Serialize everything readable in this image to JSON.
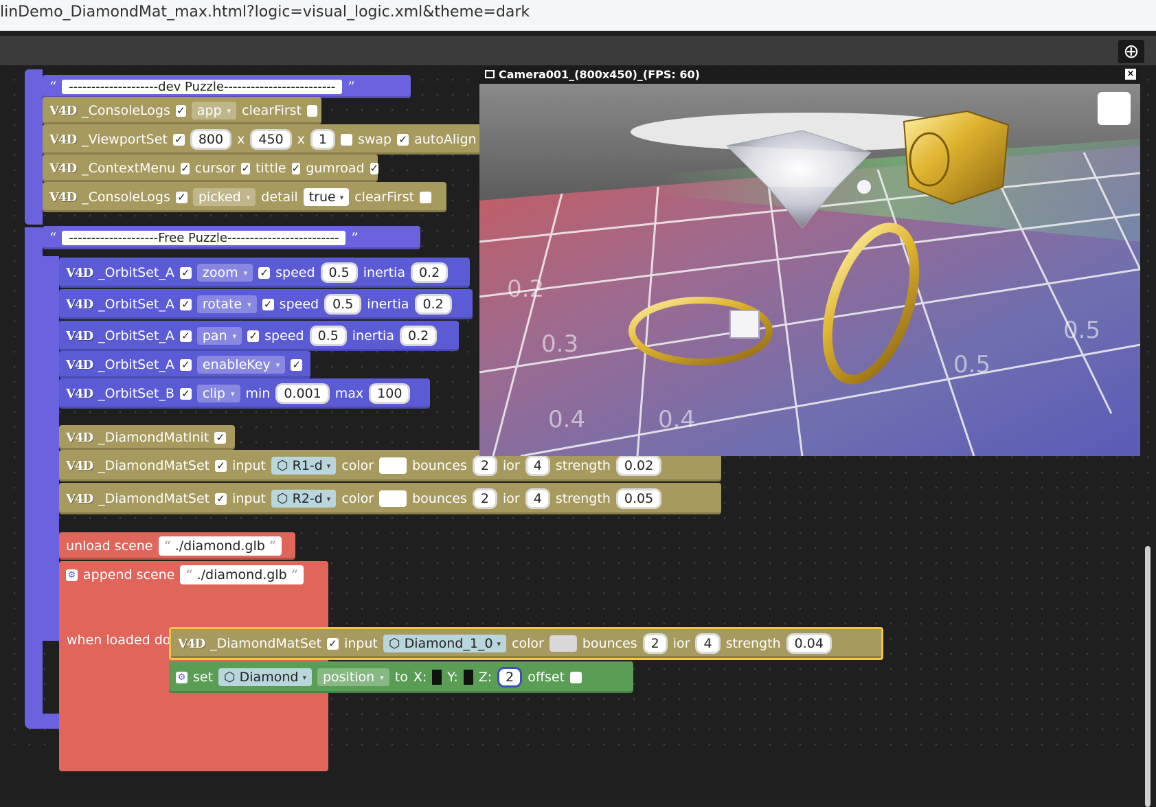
{
  "browser": {
    "url": "linDemo_DiamondMat_max.html?logic=visual_logic.xml&theme=dark"
  },
  "toolbar": {
    "add_icon": "plus-circle-icon"
  },
  "logo_text": "V4D",
  "quote_open": "“",
  "quote_close": "”",
  "check": "✓",
  "dev_puzzle": {
    "comment": "--------------------dev Puzzle-------------------------",
    "console_logs_1": {
      "name": "_ConsoleLogs",
      "dropdown": "app",
      "label": "clearFirst"
    },
    "viewport_set": {
      "name": "_ViewportSet",
      "w": "800",
      "x1": "x",
      "h": "450",
      "x2": "x",
      "scale": "1",
      "swap": "swap",
      "autoalign": "autoAlign"
    },
    "context_menu": {
      "name": "_ContextMenu",
      "cursor": "cursor",
      "tittle": "tittle",
      "gumroad": "gumroad"
    },
    "console_logs_2": {
      "name": "_ConsoleLogs",
      "dropdown": "picked",
      "detail": "detail",
      "value": "true",
      "label": "clearFirst"
    }
  },
  "free_puzzle": {
    "comment": "--------------------Free Puzzle-------------------------",
    "orbit": [
      {
        "name": "_OrbitSet_A",
        "mode": "zoom",
        "speed": "speed",
        "speed_val": "0.5",
        "inertia": "inertia",
        "inertia_val": "0.2"
      },
      {
        "name": "_OrbitSet_A",
        "mode": "rotate",
        "speed": "speed",
        "speed_val": "0.5",
        "inertia": "inertia",
        "inertia_val": "0.2"
      },
      {
        "name": "_OrbitSet_A",
        "mode": "pan",
        "speed": "speed",
        "speed_val": "0.5",
        "inertia": "inertia",
        "inertia_val": "0.2"
      }
    ],
    "orbit_key": {
      "name": "_OrbitSet_A",
      "mode": "enableKey"
    },
    "orbit_b": {
      "name": "_OrbitSet_B",
      "mode": "clip",
      "min": "min",
      "min_val": "0.001",
      "max": "max",
      "max_val": "100"
    },
    "diamond_init": {
      "name": "_DiamondMatInit"
    },
    "diamond_set": [
      {
        "name": "_DiamondMatSet",
        "input": "input",
        "obj": "R1-d",
        "color": "color",
        "bounces": "bounces",
        "bounces_val": "2",
        "ior": "ior",
        "ior_val": "4",
        "strength": "strength",
        "strength_val": "0.02"
      },
      {
        "name": "_DiamondMatSet",
        "input": "input",
        "obj": "R2-d",
        "color": "color",
        "bounces": "bounces",
        "bounces_val": "2",
        "ior": "ior",
        "ior_val": "4",
        "strength": "strength",
        "strength_val": "0.05"
      }
    ],
    "unload": {
      "label": "unload scene",
      "file": "./diamond.glb"
    },
    "append": {
      "label": "append scene",
      "file": "./diamond.glb",
      "when": "when loaded do"
    },
    "diamond_set_loaded": {
      "name": "_DiamondMatSet",
      "input": "input",
      "obj": "Diamond_1_0",
      "color": "color",
      "bounces": "bounces",
      "bounces_val": "2",
      "ior": "ior",
      "ior_val": "4",
      "strength": "strength",
      "strength_val": "0.04"
    },
    "set_block": {
      "set": "set",
      "obj": "Diamond",
      "prop": "position",
      "to": "to",
      "x": "X:",
      "y": "Y:",
      "z": "Z:",
      "z_val": "2",
      "offset": "offset"
    }
  },
  "viewport": {
    "title": "Camera001_(800x450)_(FPS: 60)",
    "close": "×"
  }
}
